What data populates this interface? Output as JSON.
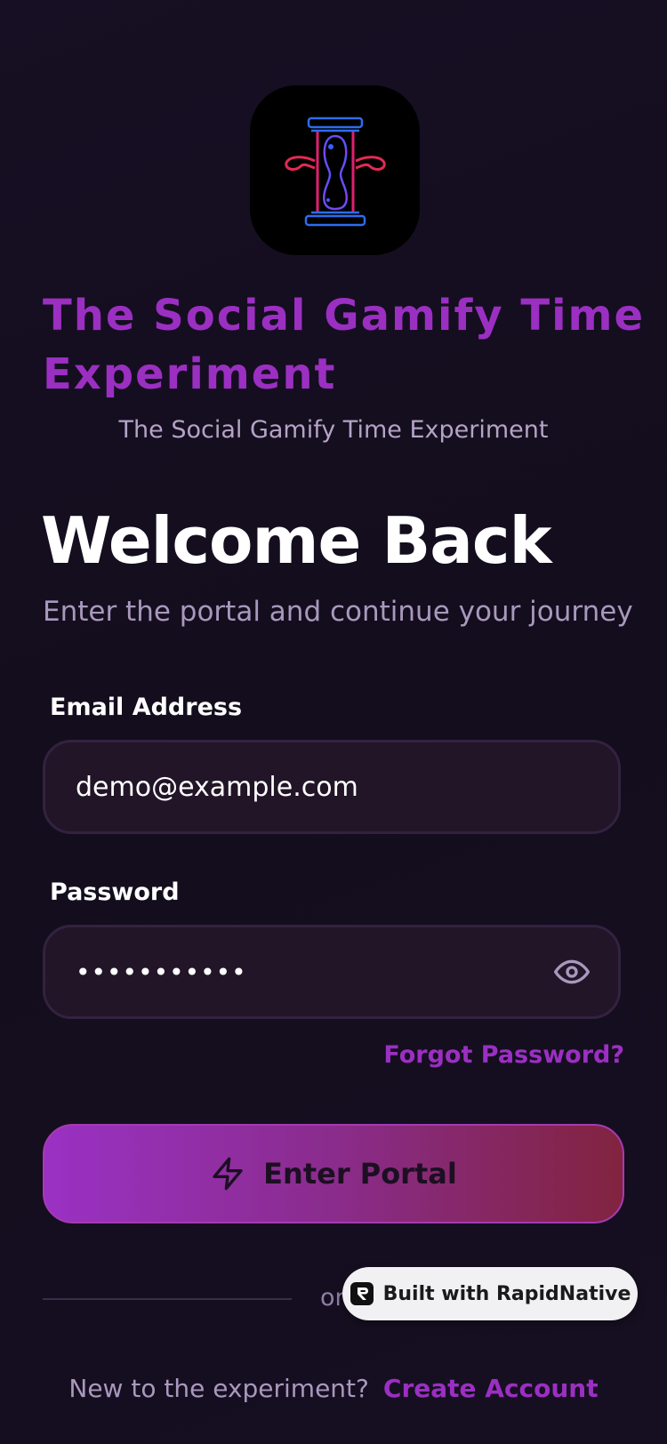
{
  "app": {
    "title": "The Social Gamify Time Experiment",
    "subtitle": "The Social Gamify Time Experiment"
  },
  "welcome": {
    "title": "Welcome Back",
    "subtitle": "Enter the portal and continue your journey"
  },
  "form": {
    "email_label": "Email Address",
    "email_value": "demo@example.com",
    "password_label": "Password",
    "password_masked": "•••••••••••",
    "forgot_label": "Forgot Password?",
    "submit_label": "Enter Portal"
  },
  "divider": {
    "text": "or"
  },
  "badge": {
    "text": "Built with RapidNative"
  },
  "footer": {
    "question": "New to the experiment?",
    "link": "Create Account"
  },
  "colors": {
    "accent": "#9b2fc2",
    "background": "#150e20",
    "input_bg": "#211527",
    "button_start": "#9a31c4",
    "button_end": "#82233f"
  },
  "icons": {
    "logo": "hourglass-icon",
    "password_toggle": "eye-icon",
    "submit": "lightning-icon",
    "badge": "rapidnative-logo-icon"
  }
}
